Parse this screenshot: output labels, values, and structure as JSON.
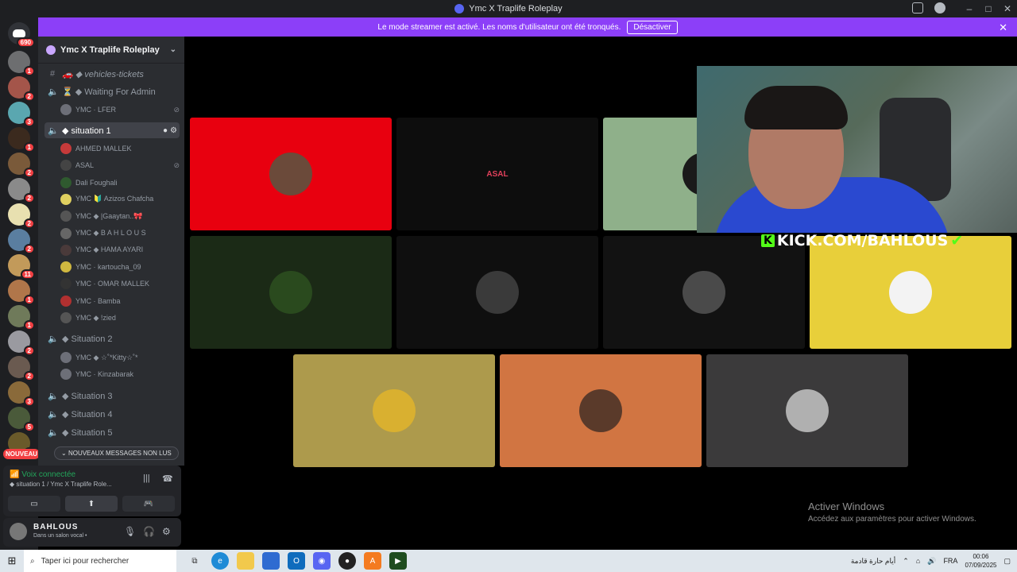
{
  "window": {
    "title": "Ymc X Traplife Roleplay"
  },
  "banner": {
    "text": "Le mode streamer est activé. Les noms d'utilisateur ont été tronqués.",
    "button": "Désactiver"
  },
  "servers": {
    "home_badge": "690",
    "badges": [
      "1",
      "2",
      "3",
      "1",
      "2",
      "2",
      "2",
      "2",
      "11",
      "1",
      "1",
      "2",
      "2",
      "3",
      "5",
      "1"
    ],
    "new_label": "NOUVEAU"
  },
  "guild": {
    "name": "Ymc X Traplife Roleplay"
  },
  "channels": [
    {
      "label": "🚗 ◆ vehicles-tickets",
      "type": "text"
    },
    {
      "label": "⏳ ◆ Waiting For Admin",
      "type": "voice"
    },
    {
      "label": "◆ situation 1",
      "type": "voice",
      "active": true
    },
    {
      "label": "◆ Situation 2",
      "type": "voice"
    },
    {
      "label": "◆ Situation 3",
      "type": "voice"
    },
    {
      "label": "◆ Situation 4",
      "type": "voice"
    },
    {
      "label": "◆ Situation 5",
      "type": "voice"
    }
  ],
  "members_waiting": [
    "YMC · LFER"
  ],
  "members_s1": [
    "AHMED MALLEK",
    "ASAL",
    "Dali Foughali",
    "YMC 🔰 Azizos Chafcha",
    "YMC ◆ |Gaaytan..🎀",
    "YMC ◆ B A H L O U S",
    "YMC ◆ HAMA AYARI",
    "YMC · kartoucha_09",
    "YMC · OMAR MALLEK",
    "YMC · Bamba",
    "YMC ◆ !zied"
  ],
  "members_s2": [
    "YMC ◆ ☆˚*Kitty☆˚*",
    "YMC · Kinzabarak"
  ],
  "unread_label": "NOUVEAUX MESSAGES NON LUS",
  "voice": {
    "status": "Voix connectée",
    "channel": "◆ situation 1 / Ymc X Traplife Role..."
  },
  "user": {
    "name": "BAHLOUS",
    "status": "Dans un salon vocal •"
  },
  "tiles": [
    {
      "color": "#e8000f",
      "avatar": "#6b4a3a"
    },
    {
      "color": "#0d0d0d",
      "mark": "ASAL"
    },
    {
      "color": "#8fb08a",
      "avatar": "#1a1a1a"
    },
    {
      "color": "#1b2a16",
      "avatar": "#2a4a1e"
    },
    {
      "color": "#0f0f0f",
      "avatar": "#3a3a3a"
    },
    {
      "color": "#121212",
      "avatar": "#4a4a4a"
    },
    {
      "color": "#e8cf3a",
      "avatar": "#f3f3f3"
    },
    {
      "color": "#ad9a4c",
      "avatar": "#d9b030"
    },
    {
      "color": "#d17542",
      "avatar": "#5a3a2a"
    },
    {
      "color": "#3b3a3b",
      "avatar": "#b0b0b0"
    }
  ],
  "stream_overlay": "KICK.COM/BAHLOUS",
  "activation": {
    "title": "Activer Windows",
    "subtitle": "Accédez aux paramètres pour activer Windows."
  },
  "taskbar": {
    "search": "Taper ici pour rechercher",
    "weather": "أيام حارة قادمة",
    "lang": "FRA",
    "time": "00:06",
    "date": "07/09/2025"
  }
}
